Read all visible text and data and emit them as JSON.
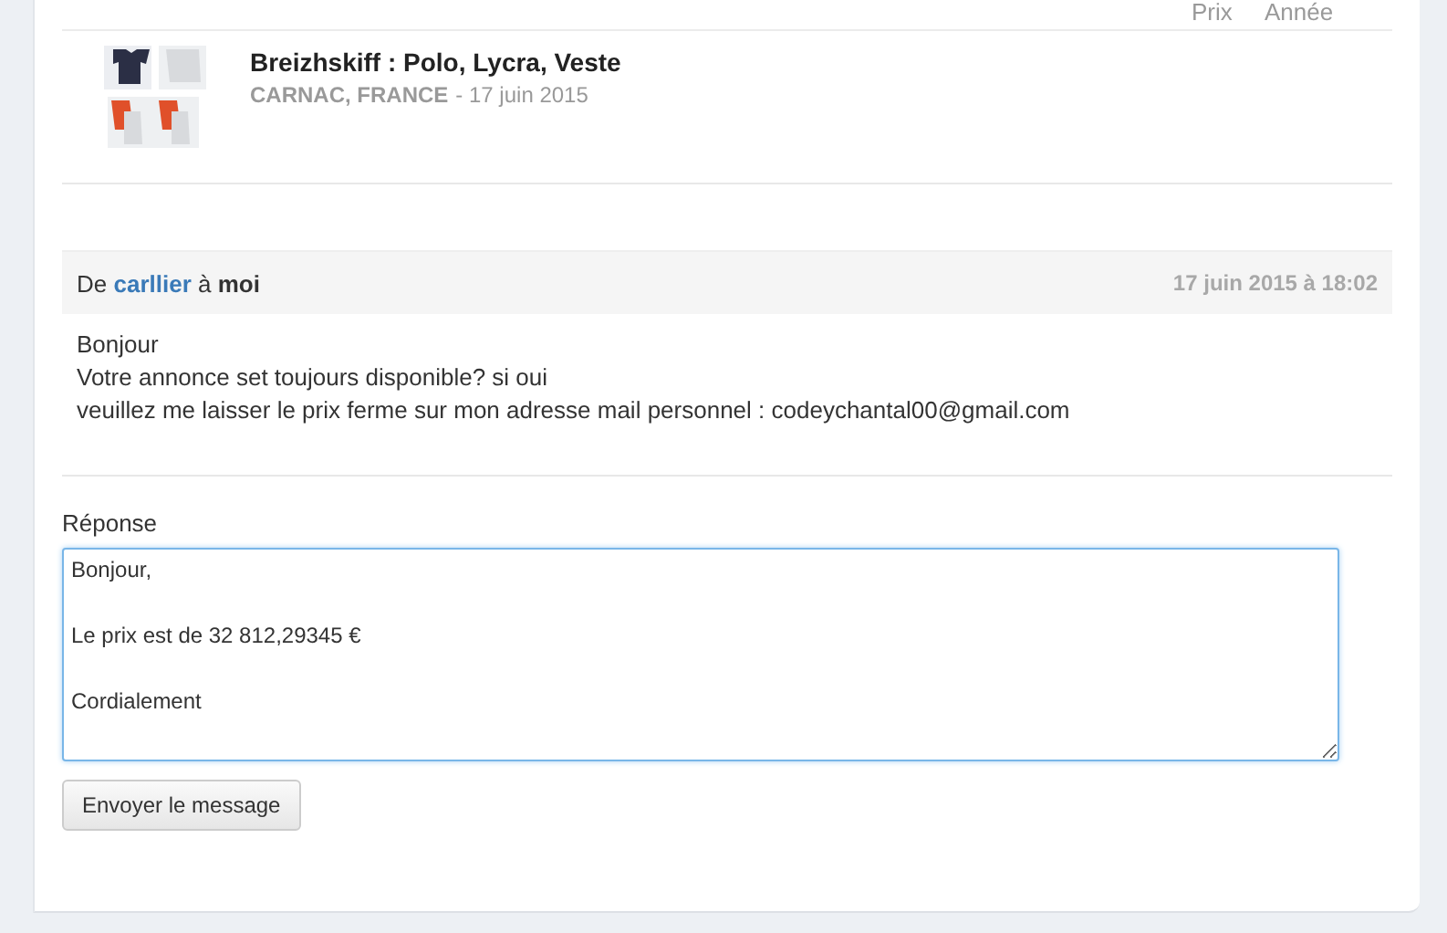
{
  "listing_header": {
    "columns": [
      "Prix",
      "Année"
    ]
  },
  "listing": {
    "title": "Breizhskiff : Polo, Lycra, Veste",
    "location": "CARNAC, FRANCE",
    "date": "- 17 juin 2015"
  },
  "message": {
    "from_prefix": "De",
    "sender": "carllier",
    "to_prefix": "à",
    "recipient": "moi",
    "timestamp": "17 juin 2015 à 18:02",
    "body": [
      "Bonjour",
      "Votre annonce set toujours disponible? si oui",
      "veuillez me laisser le prix ferme sur mon adresse mail personnel : codeychantal00@gmail.com"
    ]
  },
  "reply": {
    "label": "Réponse",
    "value": "Bonjour,\n\nLe prix est de 32 812,29345 €\n\nCordialement\n",
    "button": "Envoyer le message"
  }
}
